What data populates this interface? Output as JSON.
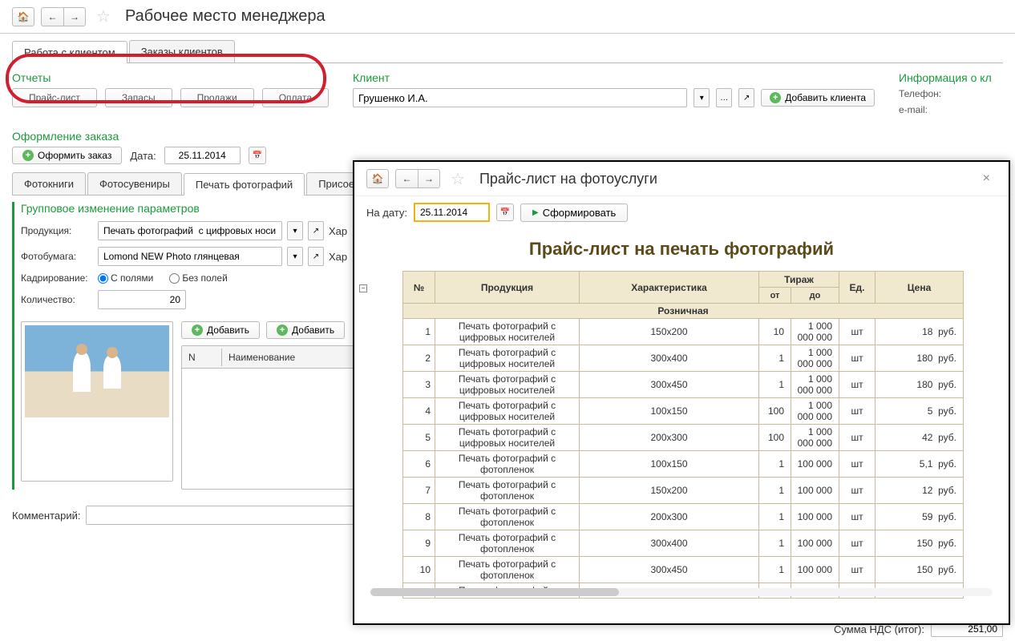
{
  "page_title": "Рабочее место менеджера",
  "main_tabs": [
    "Работа с клиентом",
    "Заказы клиентов"
  ],
  "reports": {
    "header": "Отчеты",
    "items": [
      "Прайс-лист",
      "Запасы",
      "Продажи",
      "Оплата"
    ]
  },
  "client": {
    "header": "Клиент",
    "value": "Грушенко И.А.",
    "add_label": "Добавить клиента"
  },
  "info": {
    "header": "Информация о кл",
    "phone_label": "Телефон:",
    "email_label": "e-mail:"
  },
  "order": {
    "header": "Оформление заказа",
    "create_label": "Оформить заказ",
    "date_label": "Дата:",
    "date_value": "25.11.2014",
    "sub_tabs": [
      "Фотокниги",
      "Фотосувениры",
      "Печать фотографий",
      "Присоед"
    ],
    "group_header": "Групповое изменение параметров",
    "product_label": "Продукция:",
    "product_value": "Печать фотографий  с цифровых носи",
    "paper_label": "Фотобумага:",
    "paper_value": "Lomond NEW Photo глянцевая",
    "crop_label": "Кадрирование:",
    "crop_with": "С полями",
    "crop_without": "Без полей",
    "qty_label": "Количество:",
    "qty_value": "20",
    "char_label": "Хар",
    "add_btn": "Добавить",
    "table_n": "N",
    "table_name": "Наименование",
    "comment_label": "Комментарий:"
  },
  "bottom": {
    "sum_label": "Сумма НДС (итог):",
    "sum_value": "251,00"
  },
  "modal": {
    "title": "Прайс-лист на фотоуслуги",
    "date_label": "На дату:",
    "date_value": "25.11.2014",
    "generate_label": "Сформировать",
    "report_title": "Прайс-лист  на печать фотографий",
    "columns": {
      "num": "№",
      "product": "Продукция",
      "char": "Характеристика",
      "run": "Тираж",
      "run_from": "от",
      "run_to": "до",
      "unit": "Ед.",
      "price": "Цена"
    },
    "group_name": "Розничная",
    "big_to": "1 000 000 000",
    "small_to": "100 000",
    "currency": "руб.",
    "unit": "шт",
    "rows": [
      {
        "n": "1",
        "prod": "Печать фотографий  с цифровых носителей",
        "char": "150х200",
        "from": "10",
        "to_key": "big_to",
        "price": "18"
      },
      {
        "n": "2",
        "prod": "Печать фотографий  с цифровых носителей",
        "char": "300х400",
        "from": "1",
        "to_key": "big_to",
        "price": "180"
      },
      {
        "n": "3",
        "prod": "Печать фотографий  с цифровых носителей",
        "char": "300х450",
        "from": "1",
        "to_key": "big_to",
        "price": "180"
      },
      {
        "n": "4",
        "prod": "Печать фотографий  с цифровых носителей",
        "char": "100х150",
        "from": "100",
        "to_key": "big_to",
        "price": "5"
      },
      {
        "n": "5",
        "prod": "Печать фотографий  с цифровых носителей",
        "char": "200х300",
        "from": "100",
        "to_key": "big_to",
        "price": "42"
      },
      {
        "n": "6",
        "prod": "Печать фотографий  с фотопленок",
        "char": "100х150",
        "from": "1",
        "to_key": "small_to",
        "price": "5,1"
      },
      {
        "n": "7",
        "prod": "Печать фотографий  с фотопленок",
        "char": "150х200",
        "from": "1",
        "to_key": "small_to",
        "price": "12"
      },
      {
        "n": "8",
        "prod": "Печать фотографий  с фотопленок",
        "char": "200х300",
        "from": "1",
        "to_key": "small_to",
        "price": "59"
      },
      {
        "n": "9",
        "prod": "Печать фотографий  с фотопленок",
        "char": "300х400",
        "from": "1",
        "to_key": "small_to",
        "price": "150"
      },
      {
        "n": "10",
        "prod": "Печать фотографий  с фотопленок",
        "char": "300х450",
        "from": "1",
        "to_key": "small_to",
        "price": "150"
      }
    ],
    "tail_row": "Печать  фотографий  с"
  }
}
